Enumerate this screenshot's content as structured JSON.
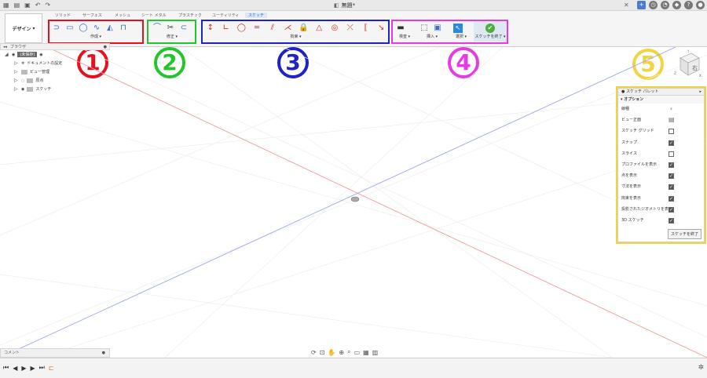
{
  "window": {
    "doc_title": "無題*"
  },
  "ribbon": {
    "workspace_label": "デザイン",
    "tabs": [
      "ソリッド",
      "サーフェス",
      "メッシュ",
      "シート メタル",
      "プラスチック",
      "ユーティリティ",
      "スケッチ"
    ],
    "active_tab": "スケッチ",
    "groups": {
      "create": "作成",
      "modify": "修正",
      "constraints": "拘束",
      "inspect": "検査",
      "insert": "挿入",
      "select": "選択",
      "finish": "スケッチを終了"
    }
  },
  "annotations": [
    "1",
    "2",
    "3",
    "4",
    "5"
  ],
  "browser": {
    "title": "ブラウザ",
    "items": [
      {
        "label": "(未保存)"
      },
      {
        "label": "ドキュメントの設定"
      },
      {
        "label": "ビュー管理"
      },
      {
        "label": "原点"
      },
      {
        "label": "スケッチ"
      }
    ]
  },
  "palette": {
    "title": "スケッチ パレット",
    "section": "オプション",
    "rows": [
      {
        "label": "線種",
        "kind": "icon",
        "checked": false
      },
      {
        "label": "ビュー正面",
        "kind": "icon",
        "checked": false
      },
      {
        "label": "スケッチ グリッド",
        "kind": "checkbox",
        "checked": false
      },
      {
        "label": "スナップ",
        "kind": "checkbox",
        "checked": true
      },
      {
        "label": "スライス",
        "kind": "checkbox",
        "checked": false
      },
      {
        "label": "プロファイルを表示",
        "kind": "checkbox",
        "checked": true
      },
      {
        "label": "点を表示",
        "kind": "checkbox",
        "checked": true
      },
      {
        "label": "寸法を表示",
        "kind": "checkbox",
        "checked": true
      },
      {
        "label": "拘束を表示",
        "kind": "checkbox",
        "checked": true
      },
      {
        "label": "投影されたジオメトリを表示",
        "kind": "checkbox",
        "checked": true
      },
      {
        "label": "3D スケッチ",
        "kind": "checkbox",
        "checked": true
      }
    ],
    "finish_button": "スケッチを終了"
  },
  "comment": {
    "label": "コメント"
  },
  "viewcube": {
    "face_label": "右",
    "axis_x": "X",
    "axis_y": "Y",
    "axis_z": "Z"
  },
  "colors": {
    "red_box": "#e8101f",
    "green_box": "#22c52a",
    "blue_box": "#1e22c8",
    "magenta_box": "#e43ce2",
    "yellow_box": "#f2d440",
    "accent": "#1a66c9"
  }
}
